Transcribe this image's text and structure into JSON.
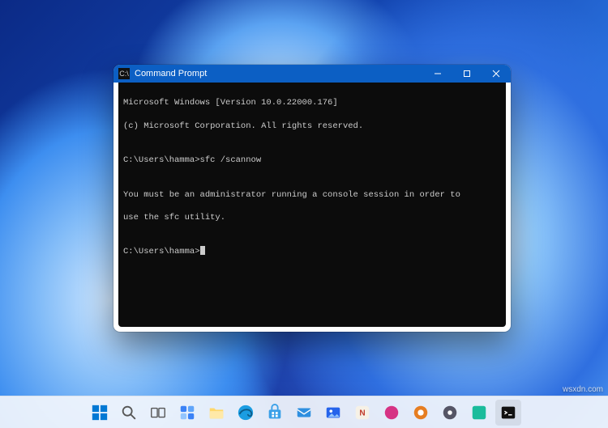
{
  "window": {
    "title": "Command Prompt"
  },
  "terminal": {
    "lines": [
      "Microsoft Windows [Version 10.0.22000.176]",
      "(c) Microsoft Corporation. All rights reserved.",
      "",
      "C:\\Users\\hamma>sfc /scannow",
      "",
      "You must be an administrator running a console session in order to",
      "use the sfc utility.",
      "",
      "C:\\Users\\hamma>"
    ]
  },
  "watermark": "wsxdn.com"
}
